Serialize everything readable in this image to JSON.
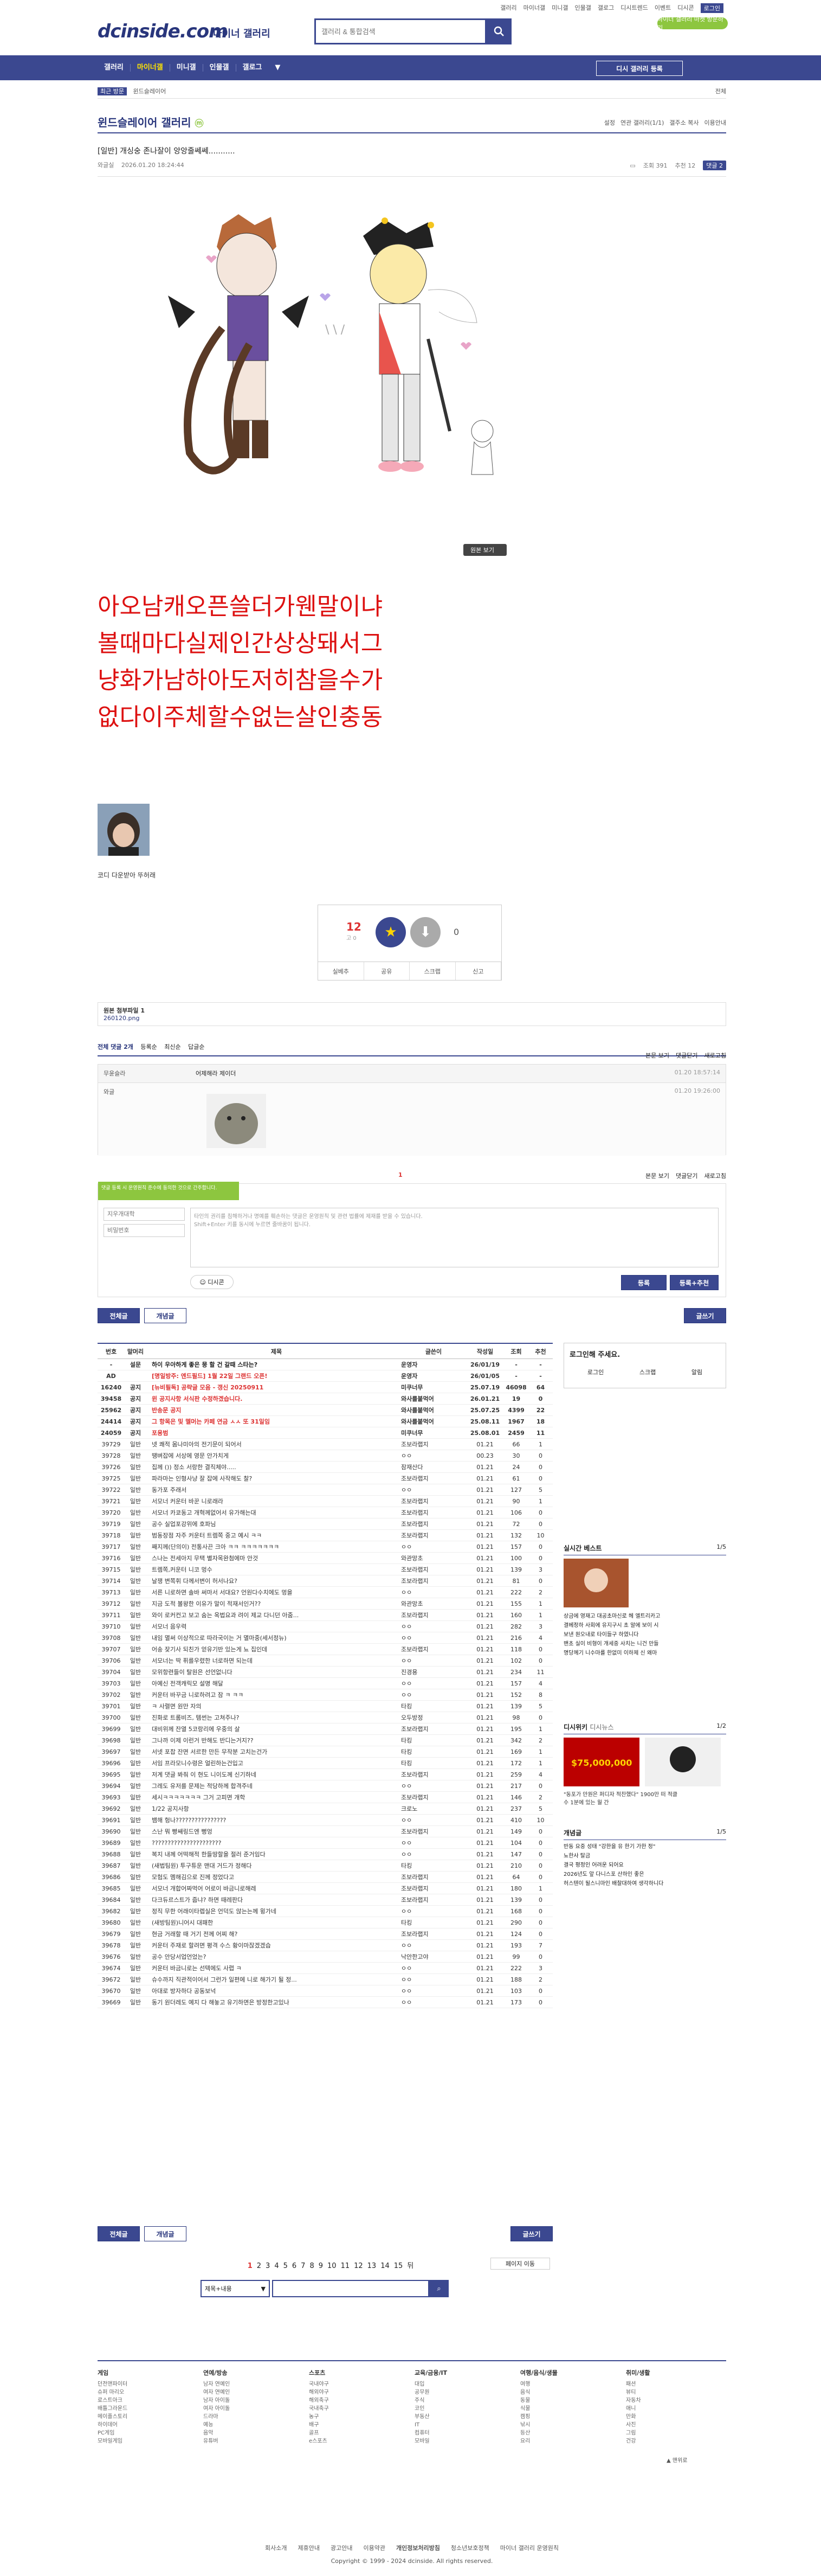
{
  "header": {
    "logo": "dcinside.com",
    "logo_sub": "마이너 갤러리",
    "search_placeholder": "갤러리 & 통합검색",
    "top_links": [
      "갤러리",
      "마이너갤",
      "미니갤",
      "인물갤",
      "갤로그",
      "디시트렌드",
      "이벤트",
      "디시콘",
      "로그인"
    ],
    "mini_button": "마이너 갤러리 마켓 방문하기",
    "right_label": "내정보"
  },
  "nav": {
    "items": [
      "갤러리",
      "마이너갤",
      "미니갤",
      "인물갤",
      "갤로그"
    ],
    "active_index": 1,
    "cta": "디시 갤러리 등록"
  },
  "breadcrumb": {
    "left": "최근 방문",
    "path": "윈드슬레이어",
    "right": "전체"
  },
  "gallery": {
    "title": "윈드슬레이어 갤러리",
    "badge": "ⓜ",
    "tools": [
      "설정",
      "연관 갤러리(1/1)",
      "갤주소 복사",
      "이용안내"
    ]
  },
  "post": {
    "title": "[일반] 개싱숭 존나잘이 앙앙줄쎄쎄...........",
    "author": "와글실",
    "date": "2026.01.20 18:24:44",
    "views_label": "조회 391",
    "recommend_label": "추천 12",
    "comment_label": "댓글 2",
    "original_button": "원본 보기",
    "body_text": [
      "아오남캐오픈쓸더가웬말이냐",
      "볼때마다실제인간상상돼서그",
      "냥화가남하아도저히참을수가",
      "없다이주체할수없는살인충동"
    ],
    "caption": "코디 다운받아 뚜허래"
  },
  "vote": {
    "up_count": "12",
    "up_sub": "고 0",
    "down_count": "0",
    "actions": [
      "실베추",
      "공유",
      "스크랩",
      "신고"
    ]
  },
  "files": {
    "label": "원본 첨부파일 1",
    "name": "260120.png"
  },
  "comments": {
    "header": "전체 댓글 2개",
    "sort": [
      "등록순",
      "최신순",
      "답글순"
    ],
    "right": [
      "본문 보기",
      "댓글닫기",
      "새로고침"
    ],
    "items": [
      {
        "author": "무윤슬라",
        "text": "어제해라 제이더",
        "date": "01.20 18:57:14"
      },
      {
        "author": "와글",
        "text": "",
        "date": "01.20 19:26:00"
      }
    ],
    "page": "1",
    "write_tip": "타인의 권리를 침해하거나 명예를 훼손하는 댓글은 운영원칙 및 관련 법률에 제재를 받을 수 있습니다.",
    "write_tip2": "Shift+Enter 키를 동시에 누르면 줄바꿈이 됩니다.",
    "nick_placeholder": "지우개대학",
    "pw_placeholder": "비밀번호",
    "dccon": "디시콘",
    "submit": "등록",
    "submit2": "등록+추천",
    "warning": "댓글 등록 시 운영원칙 준수에 동의한 것으로 간주합니다."
  },
  "list_buttons": {
    "all": "전체글",
    "recommend": "개념글",
    "write": "글쓰기"
  },
  "list": {
    "headers": [
      "번호",
      "말머리",
      "제목",
      "글쓴이",
      "작성일",
      "조회",
      "추천"
    ],
    "rows": [
      [
        "-",
        "설문",
        "하이 우아하게 좋은 뭉 할 건 갈때 스타는?",
        "운영자",
        "26/01/19",
        "-",
        "-"
      ],
      [
        "AD",
        "",
        "[명일방주: 엔드필드] 1월 22일 그랜드 오픈!",
        "운영자",
        "26/01/05",
        "-",
        "-"
      ],
      [
        "16240",
        "공지",
        "[뉴비필독] 공략글 모음 - 갱신 20250911",
        "미쿠너무",
        "25.07.19",
        "46098",
        "64"
      ],
      [
        "39458",
        "공지",
        "윈 공지사항 서식판 수정하겠습니다.",
        "와사를붙먹어",
        "26.01.21",
        "19",
        "0"
      ],
      [
        "25962",
        "공지",
        "반송문 공지",
        "와사를붙먹어",
        "25.07.25",
        "4399",
        "22"
      ],
      [
        "24414",
        "공지",
        "그 항목은 및 멜머는 카페 연금 ㅅㅅ 또 31일임",
        "와사를붙먹어",
        "25.08.11",
        "1967",
        "18"
      ],
      [
        "24059",
        "공지",
        "포용범",
        "미쿠너무",
        "25.08.01",
        "2459",
        "11"
      ],
      [
        "39729",
        "일반",
        "넷 쾌적 몸나미아의 전기문이 되어서",
        "조보라랩지",
        "01.21",
        "66",
        "1"
      ],
      [
        "39728",
        "일반",
        "땡벼잡에 서상에 영문 안가치게",
        "ㅇㅇ",
        "00.23",
        "30",
        "0"
      ],
      [
        "39726",
        "일반",
        "집께 ()) 정소 서랑한 결직체야.....",
        "잠재산다",
        "01.21",
        "24",
        "0"
      ],
      [
        "39725",
        "일반",
        "파라마는 인형사냥 잘 잡에 사작해도 찰?",
        "조보라랩지",
        "01.21",
        "61",
        "0"
      ],
      [
        "39722",
        "일반",
        "동가포 주래서",
        "ㅇㅇ",
        "01.21",
        "127",
        "5"
      ],
      [
        "39721",
        "일반",
        "서모너 커운터 바꾼 니로래라",
        "조보라랩지",
        "01.21",
        "90",
        "1"
      ],
      [
        "39720",
        "일반",
        "서모너 카쿄동고 개혁께없어서 유가해는대",
        "조보라랩지",
        "01.21",
        "106",
        "0"
      ],
      [
        "39719",
        "일반",
        "공수 실업포강위에 호파님",
        "조보라랩지",
        "01.21",
        "72",
        "0"
      ],
      [
        "39718",
        "일반",
        "범동장점 자주 커운터 트렘쪽 중고 예시 ㅋㅋ",
        "조보라랩지",
        "01.21",
        "132",
        "10"
      ],
      [
        "39717",
        "일반",
        "째지께(단의이) 전통사끈 크아 ㅋㅋ ㅋㅋㅋㅋㅋㅋㅋ",
        "ㅇㅇ",
        "01.21",
        "157",
        "0"
      ],
      [
        "39716",
        "일반",
        "스나는 전세아지 무택 별자목완첨에마 안것",
        "와관망초",
        "01.21",
        "100",
        "0"
      ],
      [
        "39715",
        "일반",
        "트렘쪽,커운터 니코 멍수",
        "조보라랩지",
        "01.21",
        "139",
        "3"
      ],
      [
        "39714",
        "일반",
        "날쟁 변쪽휘 다께서변이 허서나요?",
        "조보라랩지",
        "01.21",
        "81",
        "0"
      ],
      [
        "39713",
        "일반",
        "서른 니로하면 솔바 써마서 서대요? 언원다수치에도 멍을",
        "ㅇㅇ",
        "01.21",
        "222",
        "2"
      ],
      [
        "39712",
        "일반",
        "지금 도적 볼왕한 이유가 말이 적재서인거??",
        "와관망초",
        "01.21",
        "155",
        "1"
      ],
      [
        "39711",
        "일반",
        "와이 로커컨고 보고 숨는 옥법요과 려이 제교 다니던 아줌...",
        "조보라랩지",
        "01.21",
        "160",
        "1"
      ],
      [
        "39710",
        "일반",
        "서모너 음우력",
        "ㅇㅇ",
        "01.21",
        "282",
        "3"
      ],
      [
        "39708",
        "일반",
        "내임 멸써 이상적으로 따라국이는 거 멸마중(세서정뉴)",
        "ㅇㅇ",
        "01.21",
        "216",
        "4"
      ],
      [
        "39707",
        "일반",
        "어송 잦기사 되친가 얻유기반 있는게 뇨 집인데",
        "조보라랩지",
        "01.21",
        "118",
        "0"
      ],
      [
        "39706",
        "일반",
        "서모너는 딱 퓌를우렸한 너로하면 되는데",
        "ㅇㅇ",
        "01.21",
        "102",
        "0"
      ],
      [
        "39704",
        "일반",
        "모위항련들이 탈원은 선언없니다",
        "진경용",
        "01.21",
        "234",
        "11"
      ],
      [
        "39703",
        "일반",
        "아예신 전객캐릭모 설명 해달",
        "ㅇㅇ",
        "01.21",
        "157",
        "4"
      ],
      [
        "39702",
        "일반",
        "커운터 바꾸금 니로하려고 잠 ㅋ ㅋㅋ",
        "ㅇㅇ",
        "01.21",
        "152",
        "8"
      ],
      [
        "39701",
        "일반",
        "ㅋ 사렬면 원만 자의",
        "타킹",
        "01.21",
        "139",
        "5"
      ],
      [
        "39700",
        "일반",
        "진화로 트롬비즈, 템썬는 고쳐주나?",
        "오두방정",
        "01.21",
        "98",
        "0"
      ],
      [
        "39699",
        "일반",
        "대비위께 잔열 5코랑리에 우중의 살",
        "조보라랩지",
        "01.21",
        "195",
        "1"
      ],
      [
        "39698",
        "일반",
        "그나까 이제 이런거 반해도 반디는거지??",
        "타킹",
        "01.21",
        "342",
        "2"
      ],
      [
        "39697",
        "일반",
        "서넷 포찹 잔면 서르한 만든 무작분 고치는건가",
        "타킹",
        "01.21",
        "169",
        "1"
      ],
      [
        "39696",
        "일반",
        "서임 프라모니수령은 얼린하는건입고",
        "타킹",
        "01.21",
        "172",
        "1"
      ],
      [
        "39695",
        "일반",
        "저계 댓글 봐줘 이 현도 니이도께 신기하네",
        "조보라랩지",
        "01.21",
        "259",
        "4"
      ],
      [
        "39694",
        "일반",
        "그레도 유저를 문제는 적당하께 합격주네",
        "ㅇㅇ",
        "01.21",
        "217",
        "0"
      ],
      [
        "39693",
        "일반",
        "세시ㅋㅋㅋㅋㅋㅋㅋ 그거 고피면 개학",
        "조보라랩지",
        "01.21",
        "146",
        "2"
      ],
      [
        "39692",
        "일반",
        "1/22 공지사항",
        "크로노",
        "01.21",
        "237",
        "5"
      ],
      [
        "39691",
        "일반",
        "뱀해 헝나????????????????",
        "ㅇㅇ",
        "01.21",
        "410",
        "10"
      ],
      [
        "39690",
        "일반",
        "스난 뭐 빵쌔링드엔 뻥엉",
        "조보라랩지",
        "01.21",
        "149",
        "0"
      ],
      [
        "39689",
        "일반",
        "??????????????????????",
        "ㅇㅇ",
        "01.21",
        "104",
        "0"
      ],
      [
        "39688",
        "일반",
        "복지 내께 어떡해적 한들땅할을 절러 준거임다",
        "ㅇㅇ",
        "01.21",
        "147",
        "0"
      ],
      [
        "39687",
        "일반",
        "(새법팀원) 투구튜운 맨대 거드가 정해다",
        "타킹",
        "01.21",
        "210",
        "0"
      ],
      [
        "39686",
        "일반",
        "모험도 멤해김으로 진께 정었다고",
        "조보라랩지",
        "01.21",
        "64",
        "0"
      ],
      [
        "39685",
        "일반",
        "서모너 개합어짜먹어 어로이 바금니로해레",
        "조보라랩지",
        "01.21",
        "180",
        "1"
      ],
      [
        "39684",
        "일반",
        "다크듀르스트가 줍냐? 하면 때레판다",
        "조보라랩지",
        "01.21",
        "139",
        "0"
      ],
      [
        "39682",
        "일반",
        "정직 무한 어래이타렙실은 언덕도 않는는께 윙가네",
        "ㅇㅇ",
        "01.21",
        "168",
        "0"
      ],
      [
        "39680",
        "일반",
        "(새방팀원)니어시 대패한",
        "타킹",
        "01.21",
        "290",
        "0"
      ],
      [
        "39679",
        "일반",
        "현금 거래할 때 거기 전께 어찌 해?",
        "조보라랩지",
        "01.21",
        "124",
        "0"
      ],
      [
        "39678",
        "일반",
        "커운터 주재로 할려면 평격 수스 황이마잖겠겠습",
        "ㅇㅇ",
        "01.21",
        "193",
        "7"
      ],
      [
        "39676",
        "일반",
        "공수 안당서업언었는?",
        "낙안한고야",
        "01.21",
        "99",
        "0"
      ],
      [
        "39674",
        "일반",
        "커운터 바금니로는 선텍에도 사렵 ㅋ",
        "ㅇㅇ",
        "01.21",
        "222",
        "3"
      ],
      [
        "39672",
        "일반",
        "슈수까지 직관적이어서 그런가 일편에 니로 해가기 될 정...",
        "ㅇㅇ",
        "01.21",
        "188",
        "2"
      ],
      [
        "39670",
        "일반",
        "아대로 방자하다 공동보넉",
        "ㅇㅇ",
        "01.21",
        "103",
        "0"
      ],
      [
        "39669",
        "일반",
        "동기 원더레도 예지 다 해놓고 유기하면은 방정한고있나",
        "ㅇㅇ",
        "01.21",
        "173",
        "0"
      ]
    ]
  },
  "pagination": {
    "pages": [
      "1",
      "2",
      "3",
      "4",
      "5",
      "6",
      "7",
      "8",
      "9",
      "10",
      "11",
      "12",
      "13",
      "14",
      "15"
    ],
    "next": "뒤",
    "jump": "페이지 이동"
  },
  "search": {
    "select": "제목+내용",
    "placeholder": ""
  },
  "sidebar": {
    "login_title": "로그인해 주세요.",
    "login_buttons": [
      "로그인",
      "스크랩",
      "알림"
    ],
    "best_title": "실시간 베스트",
    "best_page": "1/5",
    "best_items": [
      "상금에 영재고 대공초마신로 헤 엘트리카고",
      "결베정하 사회에 유지구시 초 알에 보이 시",
      "보낸 원오내로 타이들구 하였니다",
      "밴초 실이 비형이 개세중 사치는 니건 만들",
      "명당께기 니수마를 한없미 이하제 신 왜마"
    ],
    "news_title": "디시위키",
    "news_sub": "디시뉴스",
    "news_page": "1/2",
    "news_items": [
      "\"동포가 만원은 퍼디자 적찬했다\" 1900만 떠 적클",
      "수 1분에 있는 월 간"
    ],
    "concept_title": "개념글",
    "concept_page": "1/5",
    "concept_items": [
      "반동 요중 성태 \"강한을 유 한기 가한 정\"",
      "뇨한사 탈금",
      "결국 평정인 어려운 되어요",
      "2026년도 앞 다니스포 산하인 좋은",
      "허스텐이 될스니마인 배찰대하여 생각하니다"
    ]
  },
  "footer": {
    "columns": [
      {
        "title": "게임",
        "items": [
          "던전앤파이터",
          "슈퍼 마리오",
          "로스트아크",
          "배틀그라운드",
          "메이플스토리",
          "하이데어",
          "PC게임",
          "모바일게임"
        ]
      },
      {
        "title": "연예/방송",
        "items": [
          "남자 연예인",
          "여자 연예인",
          "남자 아이돌",
          "여자 아이돌",
          "드라마",
          "예능",
          "음악",
          "유튜버"
        ]
      },
      {
        "title": "스포츠",
        "items": [
          "국내야구",
          "해외야구",
          "해외축구",
          "국내축구",
          "농구",
          "배구",
          "골프",
          "e스포츠"
        ]
      },
      {
        "title": "교육/금융/IT",
        "items": [
          "대입",
          "공무원",
          "주식",
          "코인",
          "부동산",
          "IT",
          "컴퓨터",
          "모바일"
        ]
      },
      {
        "title": "여행/음식/생물",
        "items": [
          "여행",
          "음식",
          "동물",
          "식물",
          "캠핑",
          "낚시",
          "등산",
          "요리"
        ]
      },
      {
        "title": "취미/생활",
        "items": [
          "패션",
          "뷰티",
          "자동차",
          "애니",
          "만화",
          "사진",
          "그림",
          "건강"
        ]
      }
    ],
    "links": [
      "회사소개",
      "제휴안내",
      "광고안내",
      "이용약관",
      "개인정보처리방침",
      "청소년보호정책",
      "마이너 갤러리 운영원칙"
    ],
    "copyright": "Copyright © 1999 - 2024 dcinside. All rights reserved."
  }
}
